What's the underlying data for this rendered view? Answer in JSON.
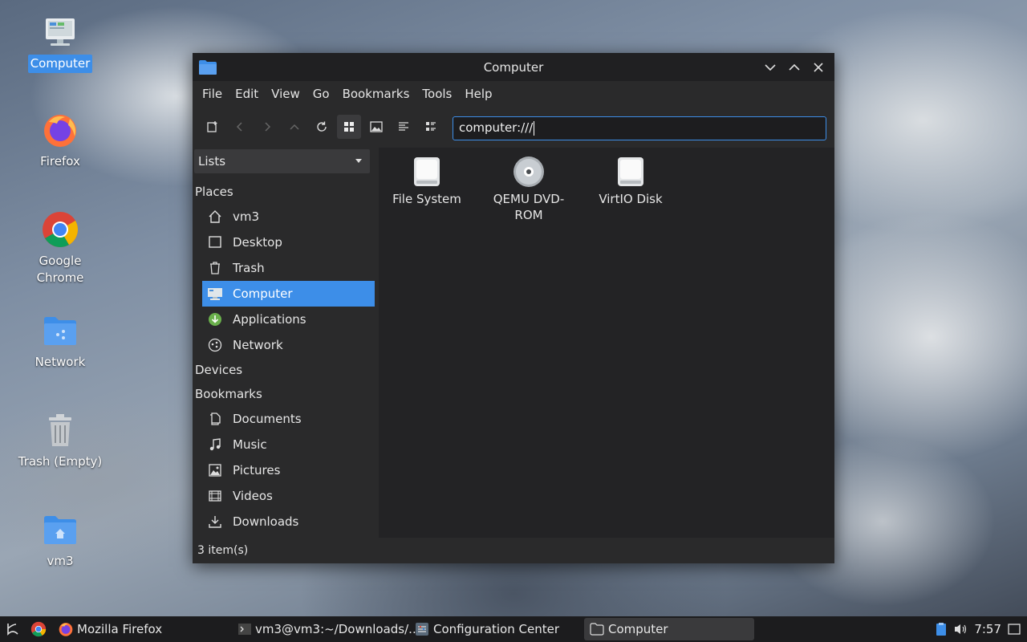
{
  "desktop": {
    "icons": [
      {
        "label": "Computer"
      },
      {
        "label": "Firefox"
      },
      {
        "label": "Google Chrome"
      },
      {
        "label": "Network"
      },
      {
        "label": "Trash (Empty)"
      },
      {
        "label": "vm3"
      }
    ]
  },
  "window": {
    "title": "Computer",
    "menu": [
      "File",
      "Edit",
      "View",
      "Go",
      "Bookmarks",
      "Tools",
      "Help"
    ],
    "location": "computer:///",
    "sidebar": {
      "combo": "Lists",
      "sections": {
        "places": "Places",
        "devices": "Devices",
        "bookmarks": "Bookmarks"
      },
      "places": [
        "vm3",
        "Desktop",
        "Trash",
        "Computer",
        "Applications",
        "Network"
      ],
      "bookmarks": [
        "Documents",
        "Music",
        "Pictures",
        "Videos",
        "Downloads"
      ]
    },
    "files": [
      "File System",
      "QEMU DVD-ROM",
      "VirtIO Disk"
    ],
    "status": "3 item(s)"
  },
  "taskbar": {
    "tasks": [
      "Mozilla Firefox",
      "vm3@vm3:~/Downloads/...",
      "Configuration Center",
      "Computer"
    ],
    "clock": "7:57"
  },
  "colors": {
    "accent": "#3d8ee8",
    "window_bg": "#2a2a2b",
    "content_bg": "#232325"
  }
}
